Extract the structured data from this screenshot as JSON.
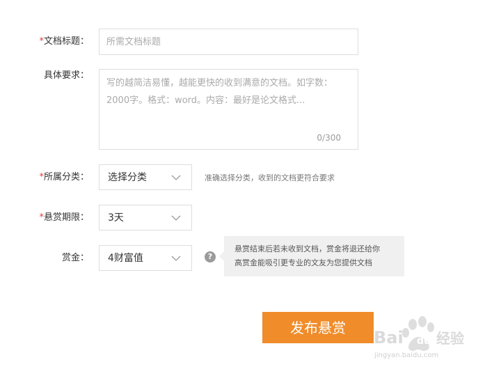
{
  "form": {
    "title": {
      "required_mark": "*",
      "label": "文档标题：",
      "placeholder": "所需文档标题"
    },
    "requirements": {
      "label": "具体要求：",
      "placeholder_line1": "写的越简洁易懂，越能更快的收到满意的文档。如字数：",
      "placeholder_line2": "2000字。格式：word。内容：最好是论文格式...",
      "counter": "0/300"
    },
    "category": {
      "required_mark": "*",
      "label": "所属分类：",
      "value": "选择分类",
      "hint": "准确选择分类，收到的文档更符合要求"
    },
    "deadline": {
      "required_mark": "*",
      "label": "悬赏期限：",
      "value": "3天"
    },
    "reward": {
      "label": "赏金：",
      "value": "4财富值",
      "help_icon_glyph": "?",
      "tip_line1": "悬赏结束后若未收到文档，赏金将退还给你",
      "tip_line2": "高赏金能吸引更专业的文友为您提供文档"
    },
    "submit_label": "发布悬赏"
  },
  "watermark": {
    "brand": "Bai",
    "brand2": "du",
    "suffix": "经验",
    "url": "jingyan.baidu.com"
  },
  "colors": {
    "accent": "#f08c2a",
    "required": "#e4393c",
    "border": "#dddddd"
  }
}
